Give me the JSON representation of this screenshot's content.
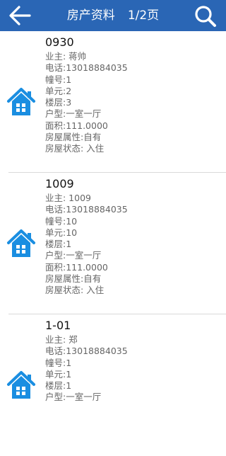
{
  "header": {
    "title": "房产资料",
    "page_indicator": "1/2页",
    "back_icon": "arrow-left-icon",
    "search_icon": "search-icon",
    "bar_color": "#2a66b5"
  },
  "icon_color": "#1a8ee1",
  "records": [
    {
      "title": "0930",
      "owner": "业主: 蒋帅",
      "phone": "电话:13018884035",
      "building": "幢号:1",
      "unit": "单元:2",
      "floor": "楼层:3",
      "layout": "户型:一室一厅",
      "area": "面积:111.0000",
      "property": "房屋属性:自有",
      "status": "房屋状态: 入住"
    },
    {
      "title": "1009",
      "owner": "业主: 1009",
      "phone": "电话:13018884035",
      "building": "幢号:10",
      "unit": "单元:10",
      "floor": "楼层:1",
      "layout": "户型:一室一厅",
      "area": "面积:111.0000",
      "property": "房屋属性:自有",
      "status": "房屋状态: 入住"
    },
    {
      "title": "1-01",
      "owner": "业主: 郑",
      "phone": "电话:13018884035",
      "building": "幢号:1",
      "unit": "单元:1",
      "floor": "楼层:1",
      "layout": "户型:一室一厅"
    }
  ]
}
